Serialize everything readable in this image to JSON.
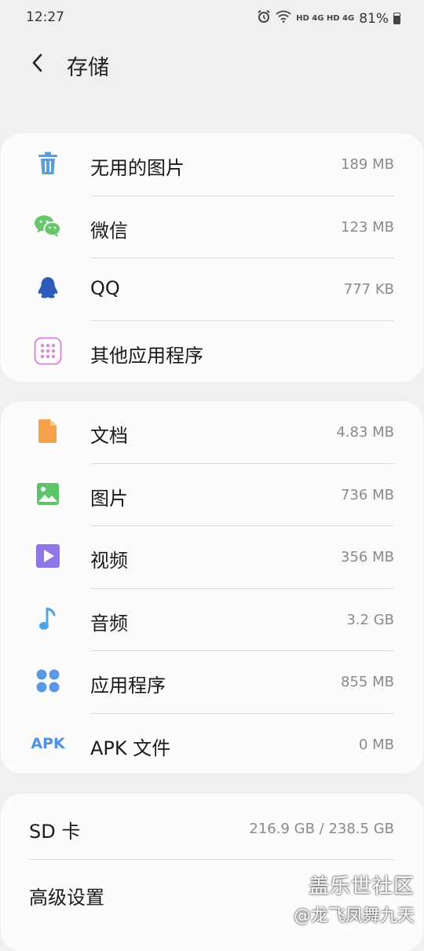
{
  "status": {
    "time": "12:27",
    "network_labels": "HD 4G HD 4G",
    "battery": "81%"
  },
  "header": {
    "title": "存储"
  },
  "apps_card": [
    {
      "label": "无用的图片",
      "value": "189 MB",
      "icon": "trash-icon",
      "color": "#5b9be0"
    },
    {
      "label": "微信",
      "value": "123 MB",
      "icon": "wechat-icon",
      "color": "#67c76a"
    },
    {
      "label": "QQ",
      "value": "777 KB",
      "icon": "qq-penguin-icon",
      "color": "#3b6fd1"
    },
    {
      "label": "其他应用程序",
      "value": "",
      "icon": "app-grid-icon",
      "color": "#d98ad9"
    }
  ],
  "files_card": [
    {
      "label": "文档",
      "value": "4.83 MB",
      "icon": "document-icon",
      "color": "#f5a04a"
    },
    {
      "label": "图片",
      "value": "736 MB",
      "icon": "image-icon",
      "color": "#5ec46a"
    },
    {
      "label": "视频",
      "value": "356 MB",
      "icon": "video-icon",
      "color": "#8f75e8"
    },
    {
      "label": "音频",
      "value": "3.2 GB",
      "icon": "music-note-icon",
      "color": "#4fa3e8"
    },
    {
      "label": "应用程序",
      "value": "855 MB",
      "icon": "apps-icon",
      "color": "#4f90e0"
    },
    {
      "label": "APK 文件",
      "value": "0 MB",
      "icon": "apk-icon",
      "icon_text": "APK",
      "color": "#4f90e0"
    }
  ],
  "settings_card": [
    {
      "label": "SD 卡",
      "value": "216.9 GB / 238.5 GB"
    },
    {
      "label": "高级设置",
      "value": ""
    }
  ],
  "watermark": {
    "line1": "盖乐世社区",
    "line2": "@龙飞凤舞九天"
  }
}
